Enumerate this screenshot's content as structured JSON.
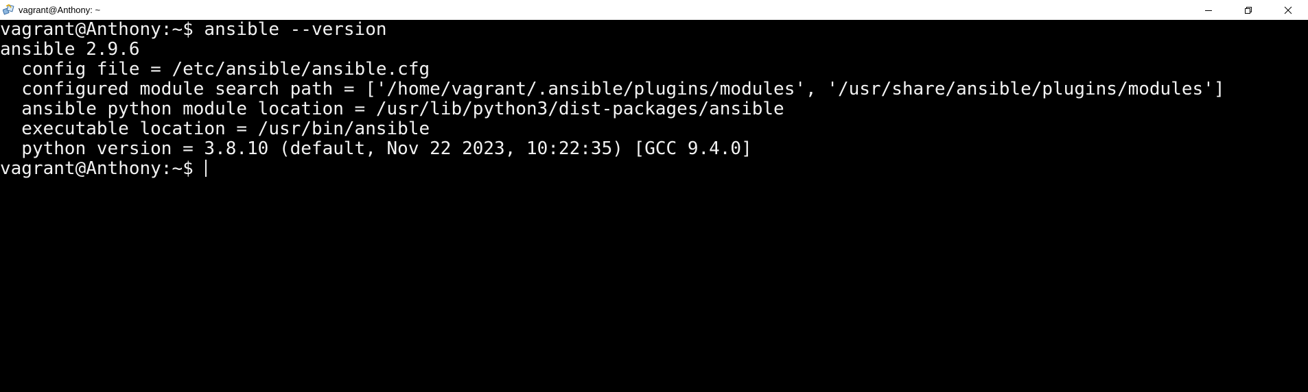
{
  "window": {
    "title": "vagrant@Anthony: ~",
    "controls": [
      "minimize-icon",
      "restore-icon",
      "close-icon"
    ]
  },
  "colors": {
    "titlebar_bg": "#ffffff",
    "terminal_bg": "#000000",
    "terminal_fg": "#f2f2f2"
  },
  "terminal": {
    "lines": [
      "vagrant@Anthony:~$ ansible --version",
      "ansible 2.9.6",
      "  config file = /etc/ansible/ansible.cfg",
      "  configured module search path = ['/home/vagrant/.ansible/plugins/modules', '/usr/share/ansible/plugins/modules']",
      "  ansible python module location = /usr/lib/python3/dist-packages/ansible",
      "  executable location = /usr/bin/ansible",
      "  python version = 3.8.10 (default, Nov 22 2023, 10:22:35) [GCC 9.4.0]"
    ],
    "prompt": "vagrant@Anthony:~$ "
  }
}
